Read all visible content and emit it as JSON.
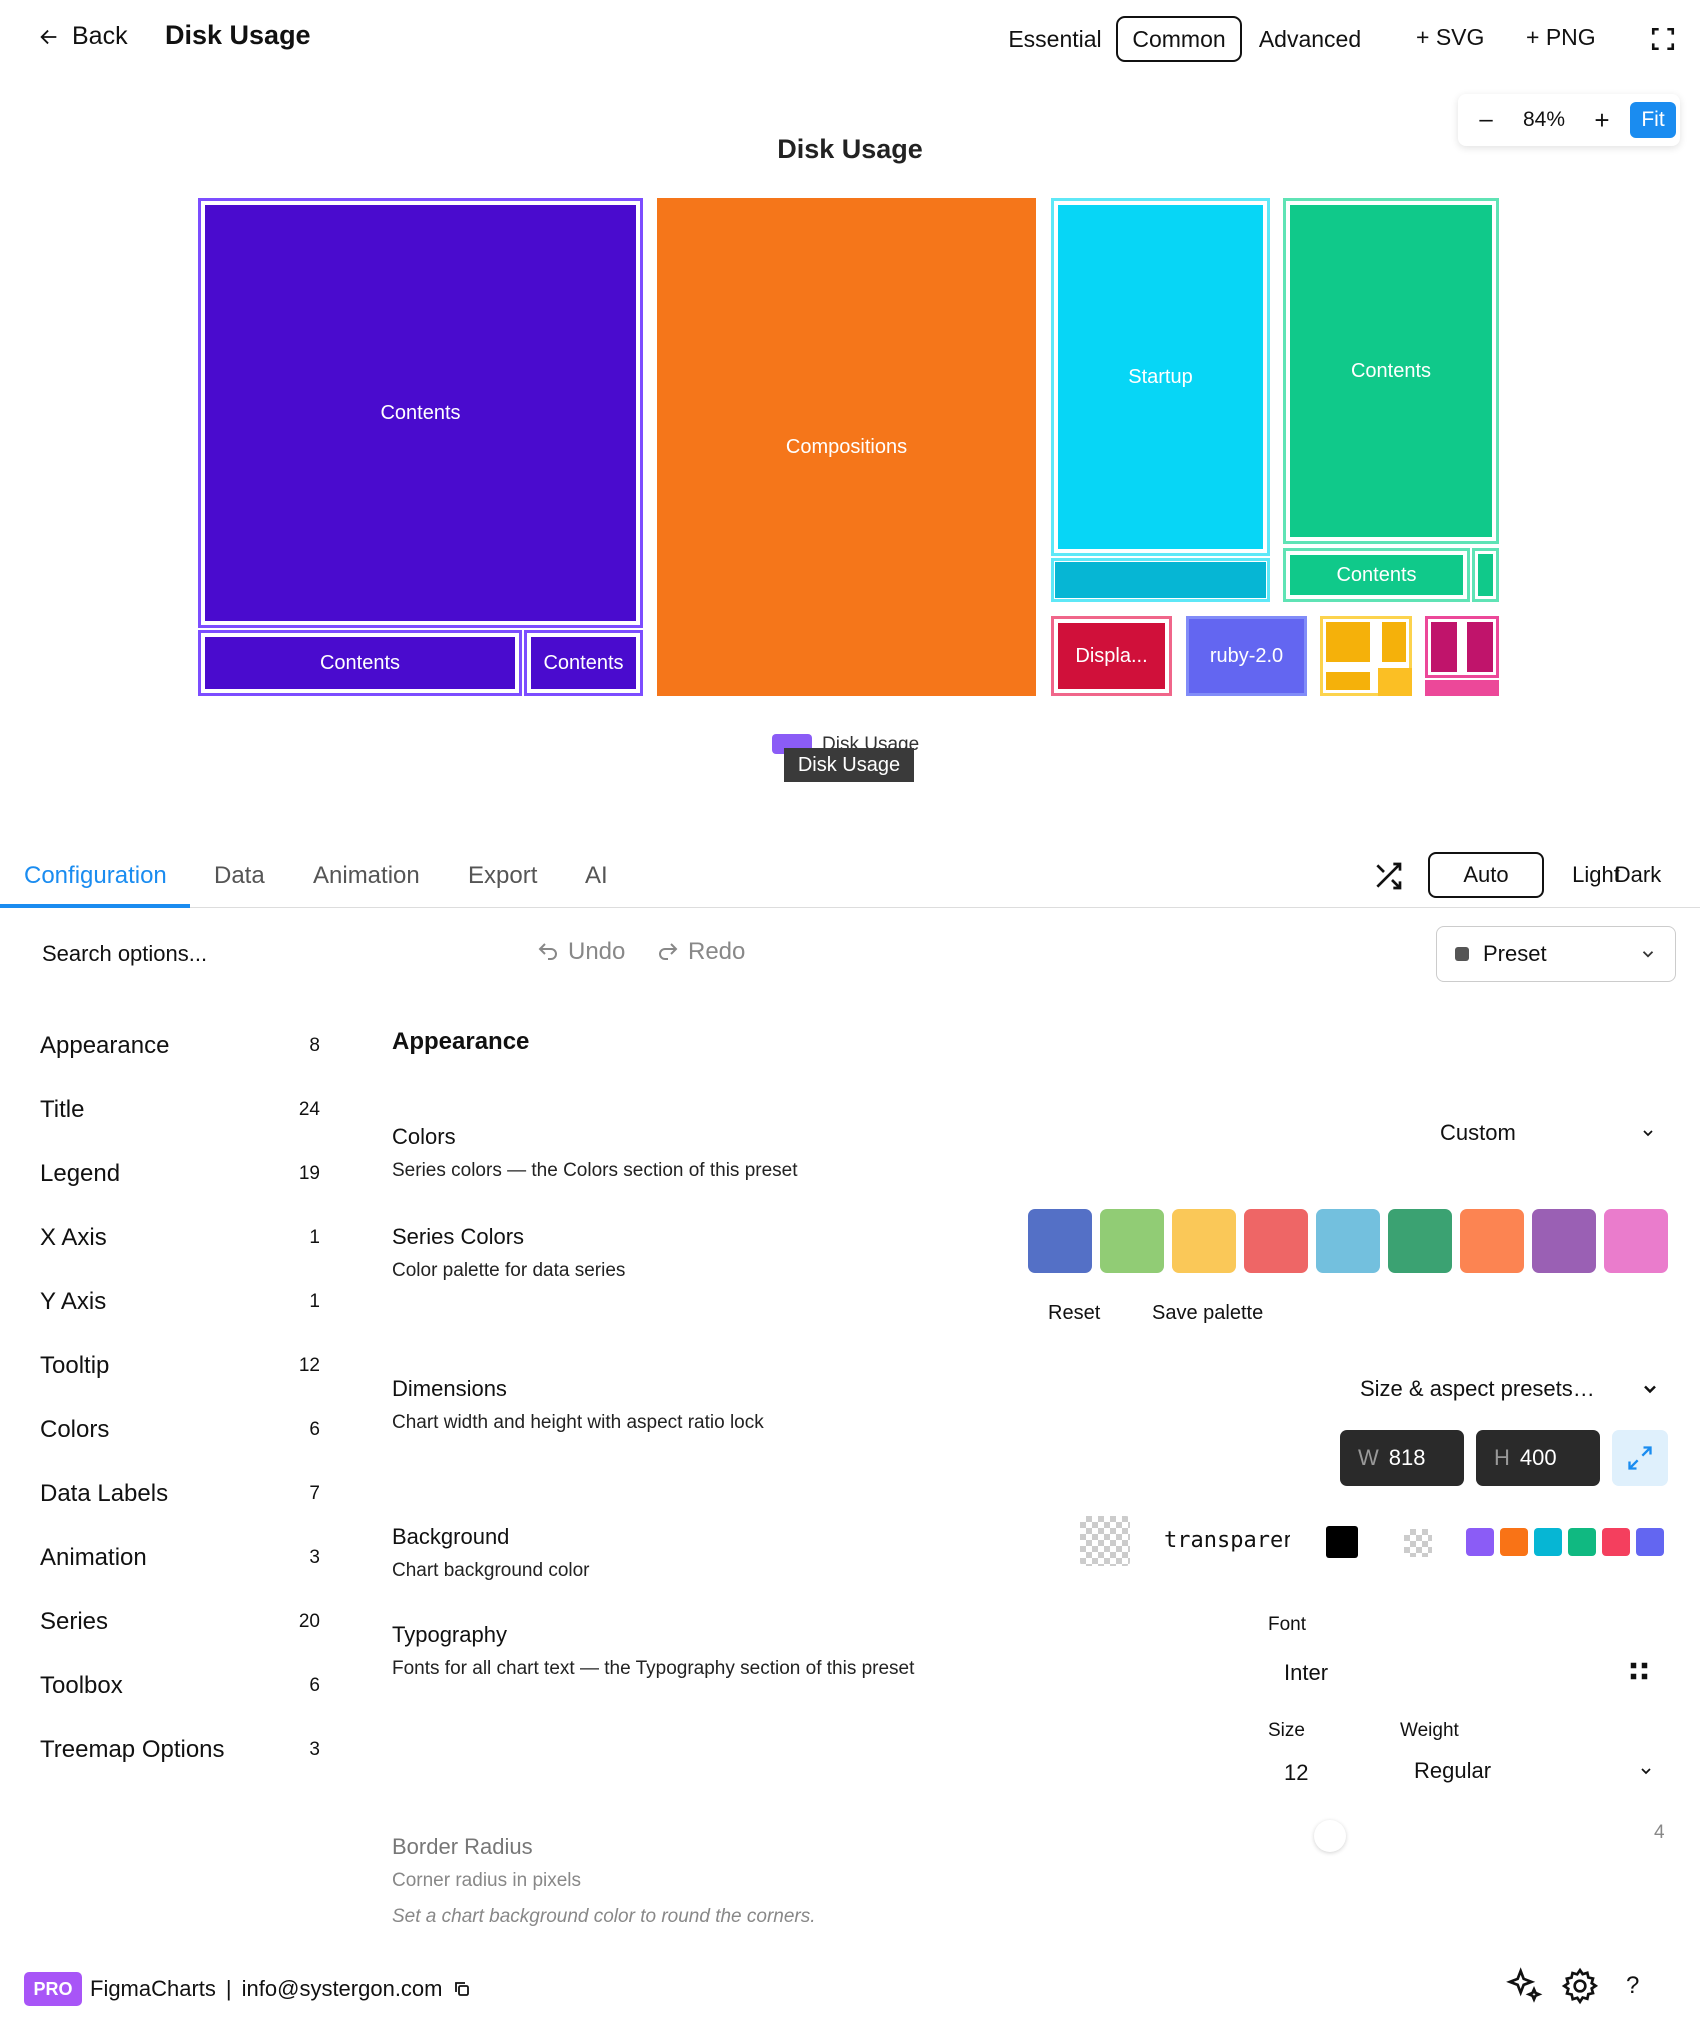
{
  "header": {
    "back_label": "Back",
    "title": "Disk Usage",
    "modes": [
      "Essential",
      "Common",
      "Advanced"
    ],
    "active_mode": "Common",
    "export_svg": "+ SVG",
    "export_png": "+ PNG"
  },
  "zoom": {
    "minus": "–",
    "value": "84%",
    "plus": "+",
    "fit": "Fit"
  },
  "chart_data": {
    "type": "treemap",
    "title": "Disk Usage",
    "legend": [
      "Disk Usage"
    ],
    "legend_placement": "bottom",
    "tooltip": "Disk Usage",
    "nodes": [
      {
        "name": "Contents",
        "color": "#4a0bce"
      },
      {
        "name": "Contents",
        "color": "#4a0bce"
      },
      {
        "name": "Contents",
        "color": "#4a0bce"
      },
      {
        "name": "Compositions",
        "color": "#f5761a"
      },
      {
        "name": "Startup",
        "color": "#07d6f6"
      },
      {
        "name": "Contents",
        "color": "#10c98a"
      },
      {
        "name": "Contents",
        "color": "#10c98a"
      },
      {
        "name": "Displa...",
        "color": "#d0103a"
      },
      {
        "name": "ruby-2.0",
        "color": "#6366f1"
      }
    ]
  },
  "tabs": [
    "Configuration",
    "Data",
    "Animation",
    "Export",
    "AI"
  ],
  "active_tab": "Configuration",
  "themes": [
    "Auto",
    "Light",
    "Dark"
  ],
  "active_theme": "Auto",
  "toolbar": {
    "search_placeholder": "Search options...",
    "undo": "Undo",
    "redo": "Redo",
    "preset": "Preset"
  },
  "sidebar": [
    {
      "label": "Appearance",
      "count": "8"
    },
    {
      "label": "Title",
      "count": "24"
    },
    {
      "label": "Legend",
      "count": "19"
    },
    {
      "label": "X Axis",
      "count": "1"
    },
    {
      "label": "Y Axis",
      "count": "1"
    },
    {
      "label": "Tooltip",
      "count": "12"
    },
    {
      "label": "Colors",
      "count": "6"
    },
    {
      "label": "Data Labels",
      "count": "7"
    },
    {
      "label": "Animation",
      "count": "3"
    },
    {
      "label": "Series",
      "count": "20"
    },
    {
      "label": "Toolbox",
      "count": "6"
    },
    {
      "label": "Treemap Options",
      "count": "3"
    }
  ],
  "appearance": {
    "title": "Appearance",
    "colors": {
      "label": "Colors",
      "desc": "Series colors — the Colors section of this preset",
      "value": "Custom"
    },
    "series_colors": {
      "label": "Series Colors",
      "desc": "Color palette for data series",
      "palette": [
        "#5470c6",
        "#91cc75",
        "#fac858",
        "#ee6666",
        "#73c0de",
        "#3ba272",
        "#fc8452",
        "#9a60b4",
        "#ea7ccc"
      ],
      "reset": "Reset",
      "save": "Save palette"
    },
    "dimensions": {
      "label": "Dimensions",
      "desc": "Chart width and height with aspect ratio lock",
      "presets": "Size & aspect presets…",
      "w_key": "W",
      "w": "818",
      "h_key": "H",
      "h": "400"
    },
    "background": {
      "label": "Background",
      "desc": "Chart background color",
      "value": "transparent",
      "quick_colors": [
        "#8b5cf6",
        "#f97316",
        "#06b6d4",
        "#10b981",
        "#f43f5e",
        "#6366f1"
      ]
    },
    "typography": {
      "label": "Typography",
      "desc": "Fonts for all chart text — the Typography section of this preset",
      "font_label": "Font",
      "font": "Inter",
      "size_label": "Size",
      "size": "12",
      "weight_label": "Weight",
      "weight": "Regular"
    },
    "border_radius": {
      "label": "Border Radius",
      "desc": "Corner radius in pixels",
      "hint": "Set a chart background color to round the corners.",
      "value": "4"
    }
  },
  "footer": {
    "badge": "PRO",
    "brand": "FigmaCharts",
    "sep": "|",
    "email": "info@systergon.com"
  }
}
